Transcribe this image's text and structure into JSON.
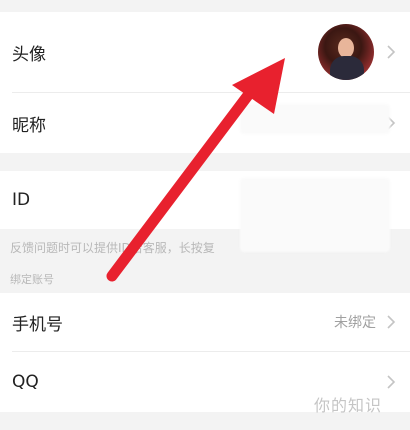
{
  "rows": {
    "avatar_label": "头像",
    "nickname_label": "昵称",
    "id_label": "ID",
    "phone_label": "手机号",
    "phone_value": "未绑定",
    "qq_label": "QQ"
  },
  "note": "反馈问题时可以提供ID给客服，长按复",
  "section_title": "绑定账号",
  "watermark": "你的知识",
  "icons": {
    "chevron": "chevron-right-icon",
    "arrow": "red-arrow-annotation"
  },
  "colors": {
    "background": "#f3f3f3",
    "arrow": "#e8212e"
  }
}
